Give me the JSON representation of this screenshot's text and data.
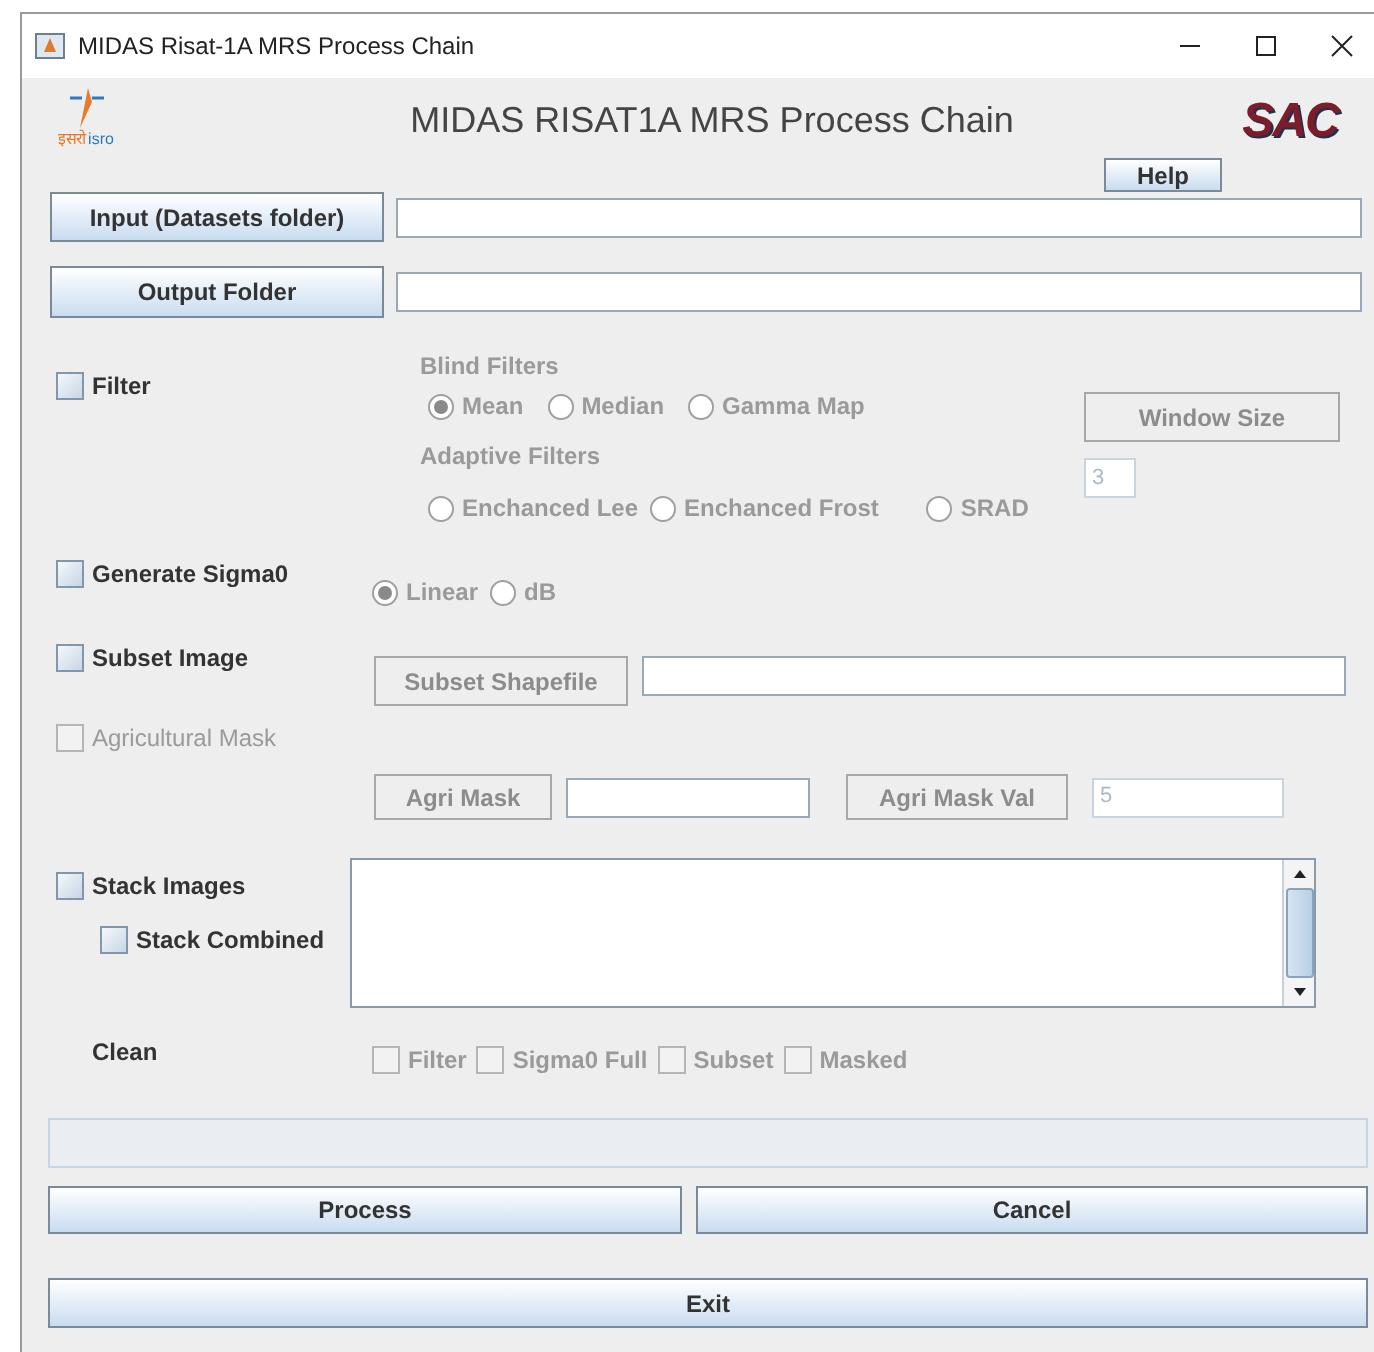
{
  "window": {
    "title": "MIDAS Risat-1A MRS Process Chain"
  },
  "header": {
    "logo_left": {
      "script": "इसरो",
      "latin": "isro"
    },
    "title": "MIDAS RISAT1A MRS Process Chain",
    "help_button": "Help",
    "logo_right": "SAC"
  },
  "input_button": "Input (Datasets folder)",
  "output_button": "Output Folder",
  "filter": {
    "label": "Filter",
    "checked": false,
    "disabled": true,
    "blind_label": "Blind Filters",
    "blind_filters": [
      {
        "label": "Mean",
        "selected": true
      },
      {
        "label": "Median",
        "selected": false
      },
      {
        "label": "Gamma Map",
        "selected": false
      }
    ],
    "adaptive_label": "Adaptive Filters",
    "adaptive_filters": [
      {
        "label": "Enchanced Lee",
        "selected": false
      },
      {
        "label": "Enchanced Frost",
        "selected": false
      },
      {
        "label": "SRAD",
        "selected": false
      }
    ],
    "window_size_button": "Window Size",
    "window_size_value": "3"
  },
  "sigma0": {
    "label": "Generate Sigma0",
    "checked": false,
    "disabled": true,
    "scales": [
      {
        "label": "Linear",
        "selected": true
      },
      {
        "label": "dB",
        "selected": false
      }
    ]
  },
  "subset": {
    "label": "Subset Image",
    "checked": false,
    "disabled": true,
    "button": "Subset Shapefile"
  },
  "agri": {
    "label": "Agricultural Mask",
    "checked": false,
    "disabled": true,
    "mask_button": "Agri Mask",
    "mask_value_button": "Agri Mask Val",
    "mask_value": "5"
  },
  "stack": {
    "label": "Stack Images",
    "checked": false,
    "combined": {
      "label": "Stack Combined",
      "checked": false
    }
  },
  "clean": {
    "label": "Clean",
    "disabled": true,
    "options": [
      {
        "label": "Filter",
        "checked": false
      },
      {
        "label": "Sigma0 Full",
        "checked": false
      },
      {
        "label": "Subset",
        "checked": false
      },
      {
        "label": "Masked",
        "checked": false
      }
    ]
  },
  "process_button": "Process",
  "cancel_button": "Cancel",
  "exit_button": "Exit"
}
